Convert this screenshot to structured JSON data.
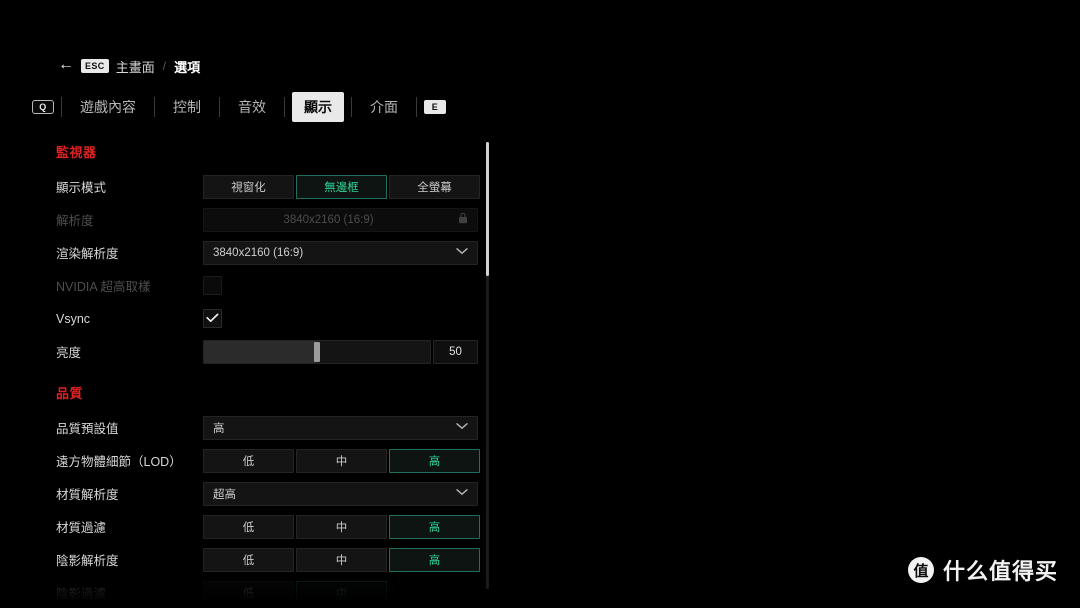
{
  "breadcrumb": {
    "back_icon": "arrow-left-icon",
    "esc_key": "ESC",
    "home_label": "主畫面",
    "separator": "/",
    "current_label": "選項"
  },
  "tabbar": {
    "prev_key": "Q",
    "next_key": "E",
    "tabs": [
      {
        "label": "遊戲內容",
        "active": false
      },
      {
        "label": "控制",
        "active": false
      },
      {
        "label": "音效",
        "active": false
      },
      {
        "label": "顯示",
        "active": true
      },
      {
        "label": "介面",
        "active": false
      }
    ]
  },
  "colors": {
    "accent_red": "#e02121",
    "accent_teal": "#2fd69c",
    "panel_bg": "#000000"
  },
  "sections": [
    {
      "title": "監視器",
      "rows": [
        {
          "label": "顯示模式",
          "type": "segmented",
          "options": [
            "視窗化",
            "無邊框",
            "全螢幕"
          ],
          "selected": "無邊框",
          "disabled": false
        },
        {
          "label": "解析度",
          "type": "readonly",
          "value": "3840x2160 (16:9)",
          "lock_icon": "lock-icon",
          "disabled": true
        },
        {
          "label": "渲染解析度",
          "type": "dropdown",
          "value": "3840x2160 (16:9)",
          "disabled": false
        },
        {
          "label": "NVIDIA 超高取樣",
          "type": "checkbox",
          "checked": false,
          "disabled": true
        },
        {
          "label": "Vsync",
          "type": "checkbox",
          "checked": true,
          "disabled": false
        },
        {
          "label": "亮度",
          "type": "slider",
          "value": 50,
          "min": 0,
          "max": 100,
          "disabled": false
        }
      ]
    },
    {
      "title": "品質",
      "rows": [
        {
          "label": "品質預設值",
          "type": "dropdown",
          "value": "高",
          "disabled": false
        },
        {
          "label": "遠方物體細節（LOD）",
          "type": "segmented",
          "options": [
            "低",
            "中",
            "高"
          ],
          "selected": "高",
          "disabled": false
        },
        {
          "label": "材質解析度",
          "type": "dropdown",
          "value": "超高",
          "disabled": false
        },
        {
          "label": "材質過濾",
          "type": "segmented",
          "options": [
            "低",
            "中",
            "高"
          ],
          "selected": "高",
          "disabled": false
        },
        {
          "label": "陰影解析度",
          "type": "segmented",
          "options": [
            "低",
            "中",
            "高"
          ],
          "selected": "高",
          "disabled": false
        },
        {
          "label": "陰影過濾",
          "type": "segmented",
          "options": [
            "低",
            "中"
          ],
          "selected": "中",
          "disabled": false,
          "clipped": true
        }
      ]
    }
  ],
  "scrollbar": {
    "thumb_top_pct": 0,
    "thumb_height_pct": 30
  },
  "watermark": {
    "logo_char": "值",
    "text": "什么值得买"
  }
}
